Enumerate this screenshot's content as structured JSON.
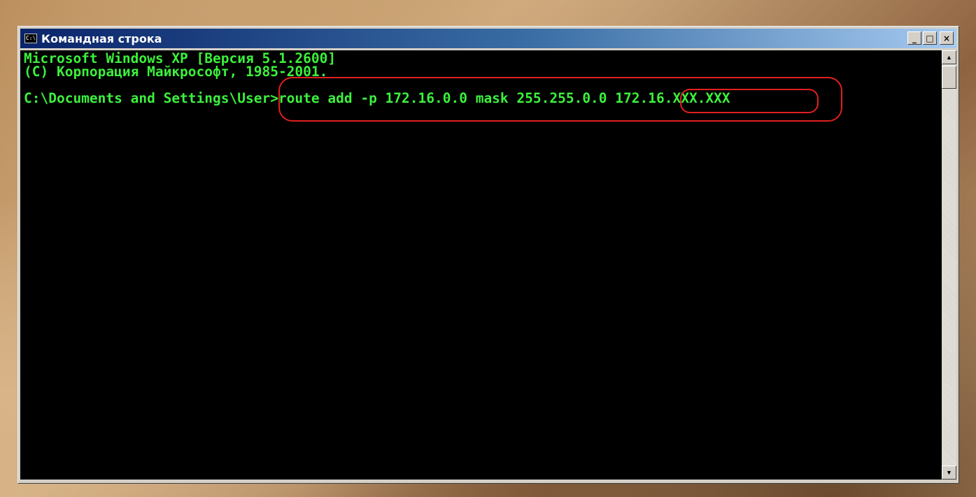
{
  "window": {
    "title": "Командная строка",
    "controls": {
      "minimize": "_",
      "maximize": "□",
      "close": "×"
    }
  },
  "console": {
    "lines": [
      "Microsoft Windows XP [Версия 5.1.2600]",
      "(C) Корпорация Майкрософт, 1985-2001.",
      "",
      "C:\\Documents and Settings\\User>route add -p 172.16.0.0 mask 255.255.0.0 172.16.XXX.XXX"
    ]
  },
  "scrollbar": {
    "up_arrow": "▲",
    "down_arrow": "▼"
  },
  "colors": {
    "console_text": "#3cf03c",
    "console_bg": "#000000",
    "annotation": "#e02020",
    "titlebar_start": "#0a246a",
    "titlebar_end": "#a6caf0"
  }
}
